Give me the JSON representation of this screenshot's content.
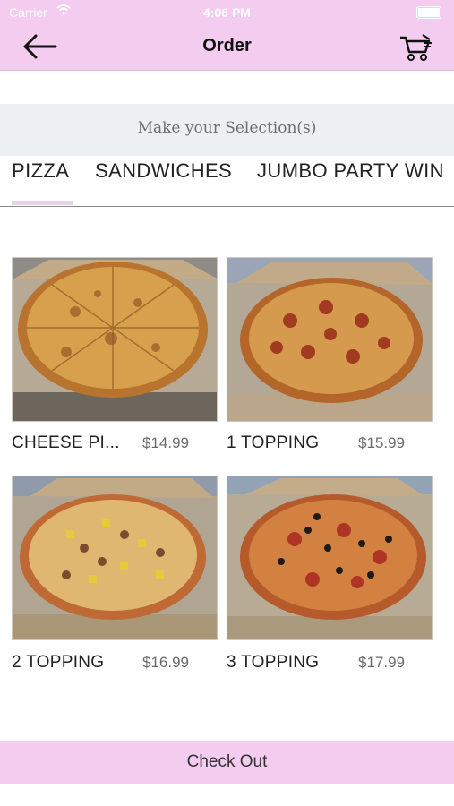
{
  "status_bar": {
    "carrier": "Carrier",
    "time": "4:06 PM"
  },
  "header": {
    "title": "Order"
  },
  "selection_prompt": "Make your Selection(s)",
  "tabs": [
    {
      "label": "PIZZA",
      "selected": true
    },
    {
      "label": "SANDWICHES",
      "selected": false
    },
    {
      "label": "JUMBO PARTY WIN",
      "selected": false
    }
  ],
  "products": [
    {
      "name": "CHEESE PI...",
      "price": "$14.99"
    },
    {
      "name": "1 TOPPING",
      "price": "$15.99"
    },
    {
      "name": "2 TOPPING",
      "price": "$16.99"
    },
    {
      "name": "3 TOPPING",
      "price": "$17.99"
    }
  ],
  "footer": {
    "checkout_label": "Check Out"
  },
  "colors": {
    "header_bg": "#f3ccef",
    "selection_bar_bg": "#ecf0f1",
    "tab_underline": "#ead1ea"
  },
  "icons": {
    "back": "arrow-left-icon",
    "cart": "shopping-cart-icon"
  }
}
